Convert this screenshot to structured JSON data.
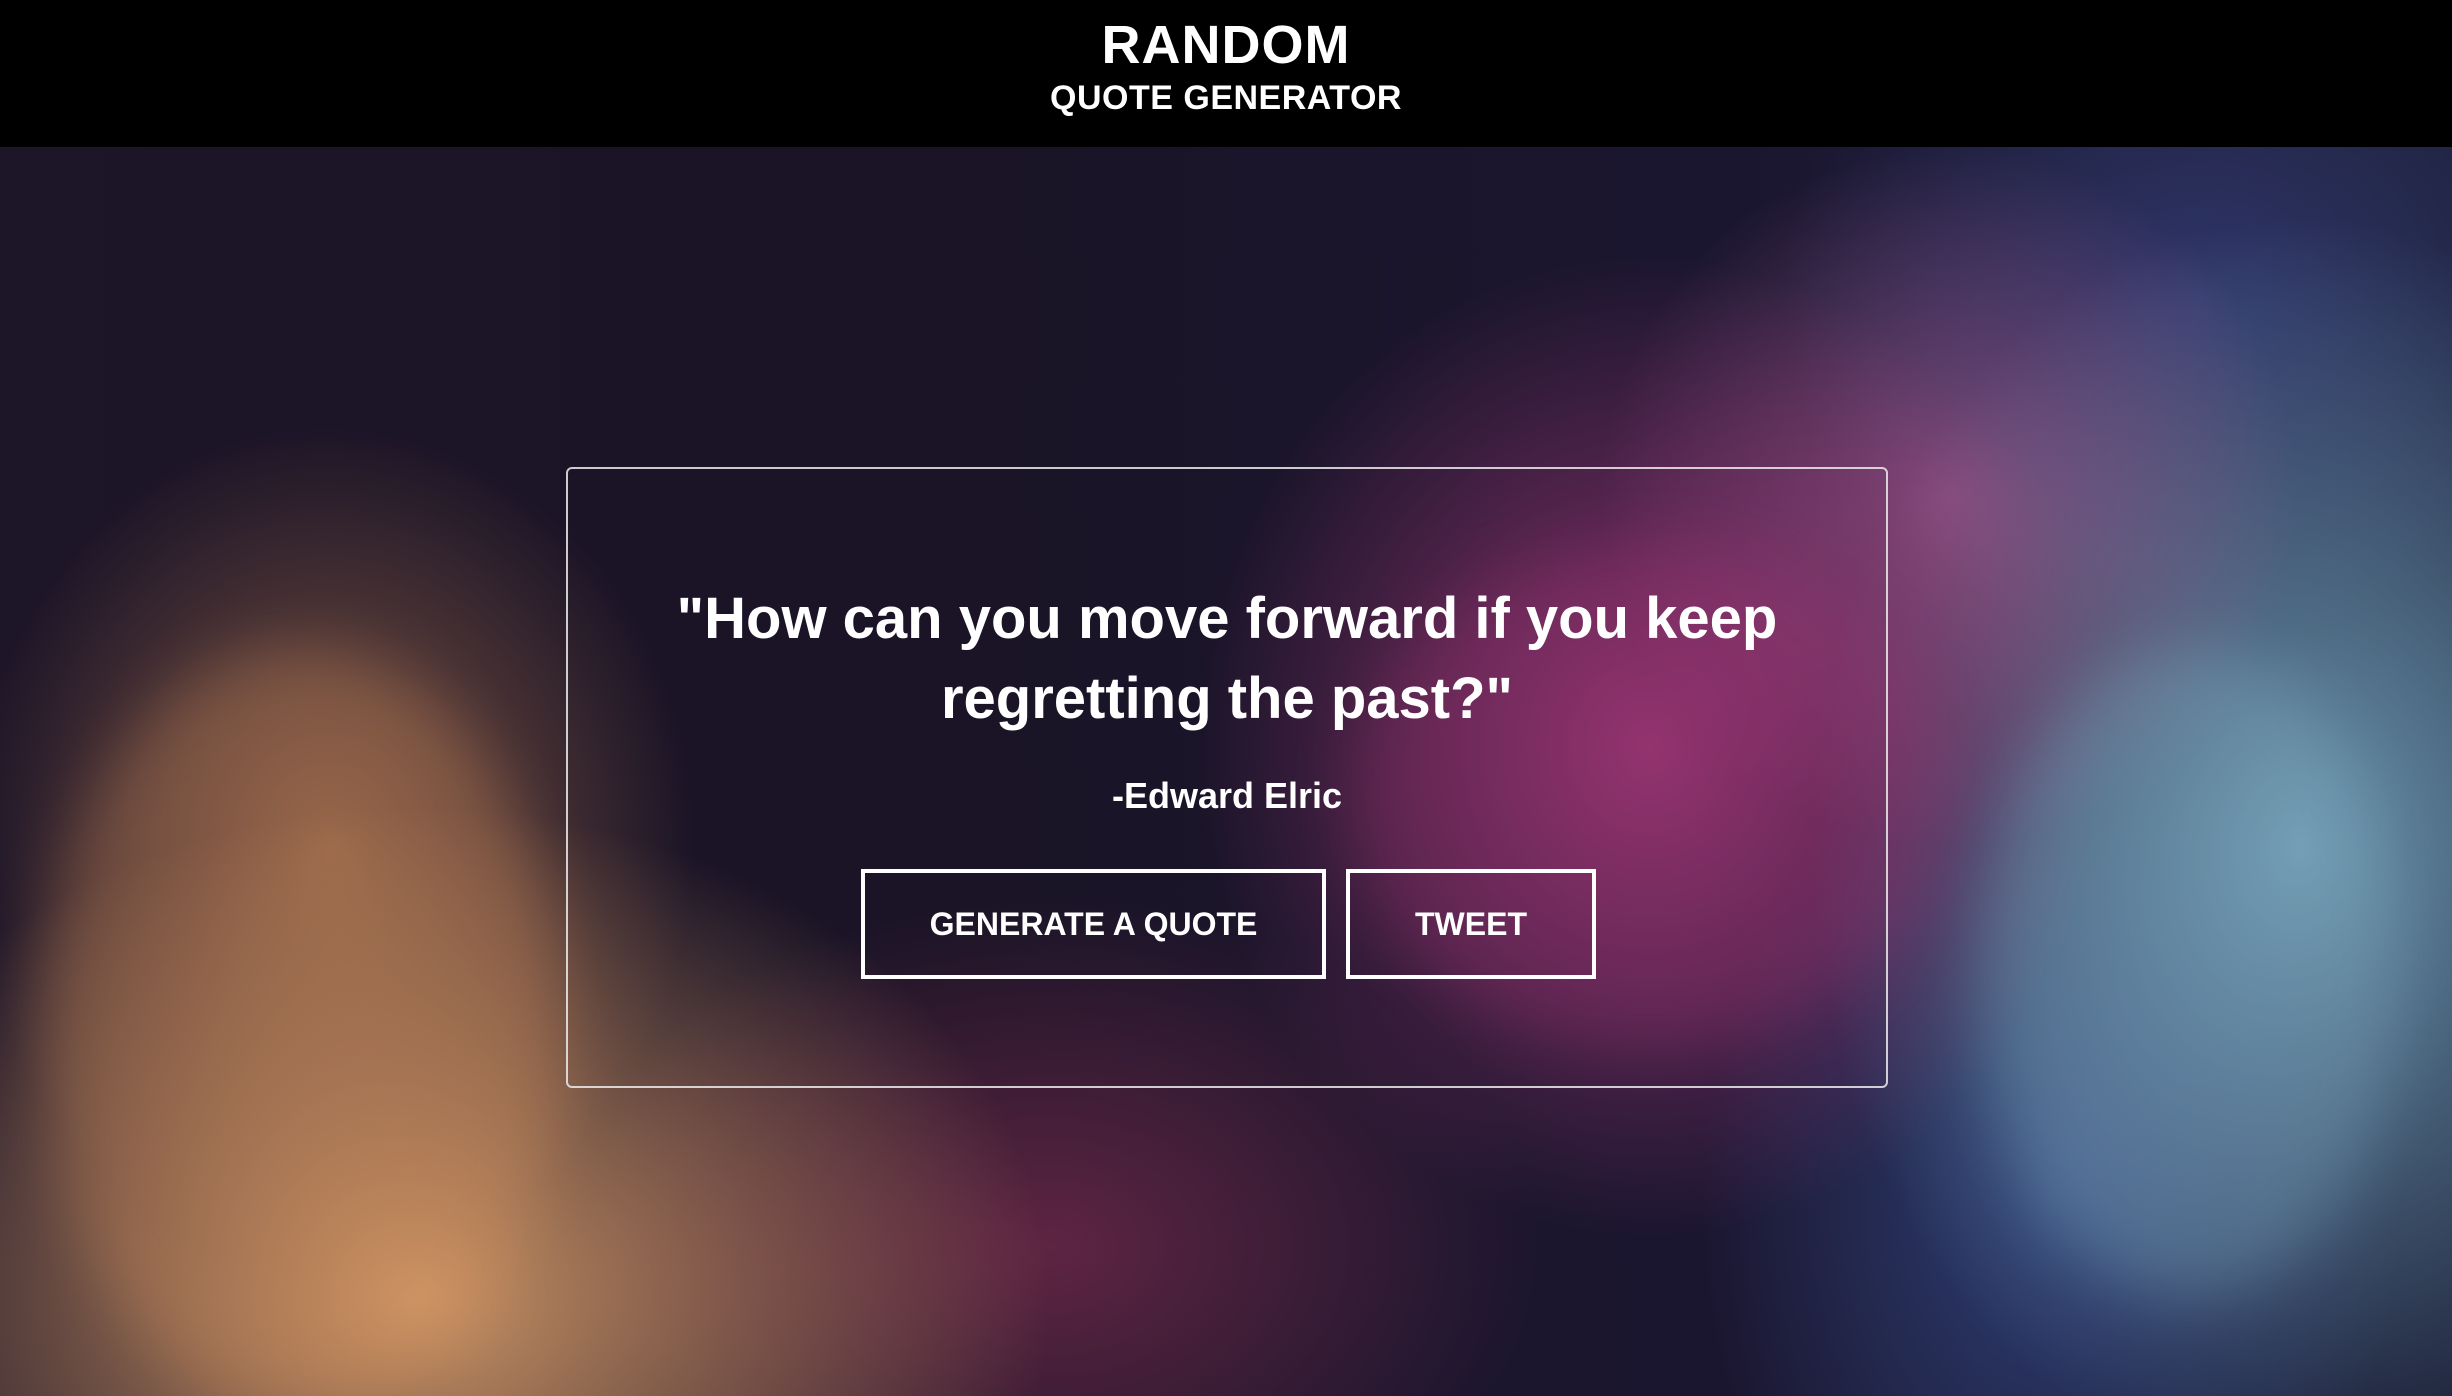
{
  "header": {
    "title": "RANDOM",
    "subtitle": "QUOTE GENERATOR"
  },
  "quote": {
    "text": "\"How can you move forward if you keep regretting the past?\"",
    "author": "-Edward Elric"
  },
  "buttons": {
    "generate_label": "GENERATE A QUOTE",
    "tweet_label": "TWEET"
  },
  "colors": {
    "header_background": "#000000",
    "text": "#ffffff",
    "button_border": "#ffffff"
  }
}
